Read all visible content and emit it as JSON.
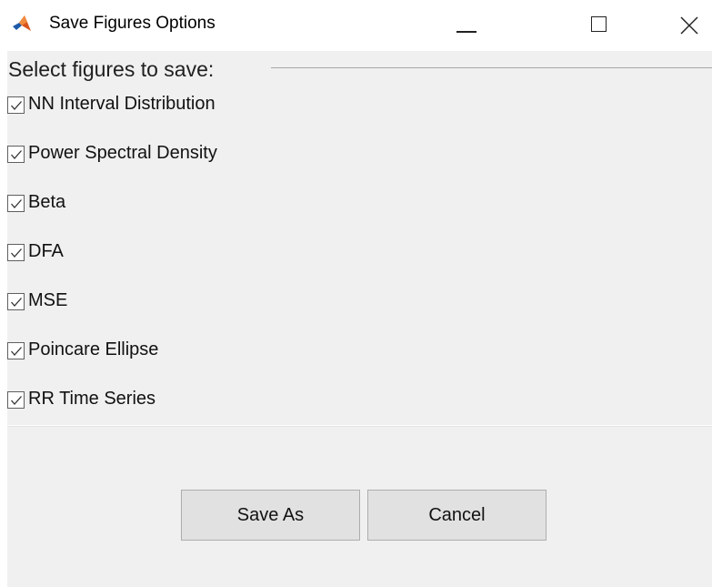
{
  "window": {
    "title": "Save Figures Options",
    "app_icon": "matlab-icon",
    "controls": [
      "minimize-icon",
      "maximize-icon",
      "close-icon"
    ]
  },
  "group": {
    "title": "Select figures to save:"
  },
  "checkboxes": [
    {
      "label": "NN Interval Distribution",
      "checked": true
    },
    {
      "label": "Power Spectral Density",
      "checked": true
    },
    {
      "label": "Beta",
      "checked": true
    },
    {
      "label": "DFA",
      "checked": true
    },
    {
      "label": "MSE",
      "checked": true
    },
    {
      "label": "Poincare Ellipse",
      "checked": true
    },
    {
      "label": "RR Time Series",
      "checked": true
    }
  ],
  "buttons": {
    "save_as": "Save As",
    "cancel": "Cancel"
  },
  "colors": {
    "client_bg": "#f0f0f0",
    "button_bg": "#e1e1e1",
    "icon_orange": "#d9531e",
    "icon_blue": "#1e5aa8"
  }
}
